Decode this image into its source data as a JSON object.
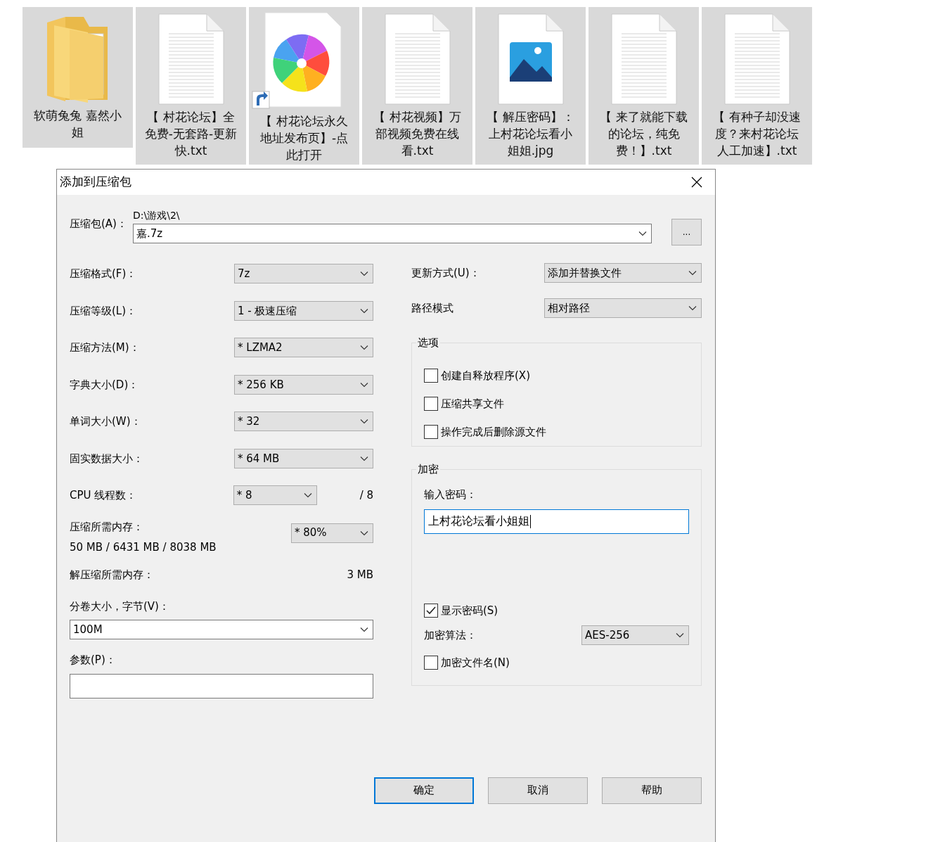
{
  "files": [
    {
      "kind": "folder",
      "name": "软萌兔兔 嘉然小姐"
    },
    {
      "kind": "text",
      "name": "【 村花论坛】全免费-无套路-更新快.txt"
    },
    {
      "kind": "shortcut",
      "name": "【 村花论坛永久地址发布页】-点此打开"
    },
    {
      "kind": "text",
      "name": "【 村花视频】万部视频免费在线看.txt"
    },
    {
      "kind": "image",
      "name": "【 解压密码】：上村花论坛看小姐姐.jpg"
    },
    {
      "kind": "text",
      "name": "【 来了就能下载的论坛，纯免费！】.txt"
    },
    {
      "kind": "text",
      "name": "【 有种子却没速度？来村花论坛人工加速】.txt"
    }
  ],
  "dialog": {
    "title": "添加到压缩包",
    "archive": {
      "label": "压缩包(A)：",
      "path": "D:\\游戏\\2\\",
      "value": "嘉.7z",
      "browse": "..."
    },
    "left_settings": [
      {
        "kind": "combo",
        "label": "压缩格式(F)：",
        "value": "7z"
      },
      {
        "kind": "combo",
        "label": "压缩等级(L)：",
        "value": "1 - 极速压缩"
      },
      {
        "kind": "combo",
        "label": "压缩方法(M)：",
        "value": "* LZMA2"
      },
      {
        "kind": "combo",
        "label": "字典大小(D)：",
        "value": "* 256 KB"
      },
      {
        "kind": "combo",
        "label": "单词大小(W)：",
        "value": "* 32"
      },
      {
        "kind": "combo",
        "label": "固实数据大小：",
        "value": "* 64 MB"
      },
      {
        "kind": "threads",
        "label": "CPU 线程数：",
        "value": "* 8",
        "reading": "/ 8"
      },
      {
        "kind": "memory",
        "label": "压缩所需内存：",
        "reading": "50 MB / 6431 MB / 8038 MB",
        "value": "* 80%"
      },
      {
        "kind": "reading",
        "label": "解压缩所需内存：",
        "reading": "3 MB"
      }
    ],
    "volume": {
      "label": "分卷大小，字节(V)：",
      "value": "100M"
    },
    "parameters": {
      "label": "参数(P)："
    },
    "right_settings": [
      {
        "label": "更新方式(U)：",
        "value": "添加并替换文件"
      },
      {
        "label": "路径模式",
        "value": "相对路径"
      }
    ],
    "options": {
      "title": "选项",
      "items": [
        {
          "label": "创建自释放程序(X)",
          "checked": false
        },
        {
          "label": "压缩共享文件",
          "checked": false
        },
        {
          "label": "操作完成后删除源文件",
          "checked": false
        }
      ]
    },
    "encryption": {
      "title": "加密",
      "password_label": "输入密码：",
      "password": "上村花论坛看小姐姐",
      "show_password": {
        "label": "显示密码(S)",
        "checked": true
      },
      "method_label": "加密算法：",
      "method": "AES-256",
      "encrypt_names": {
        "label": "加密文件名(N)",
        "checked": false
      }
    },
    "buttons": [
      {
        "label": "确定",
        "default": true
      },
      {
        "label": "取消",
        "default": false
      },
      {
        "label": "帮助",
        "default": false
      }
    ]
  }
}
